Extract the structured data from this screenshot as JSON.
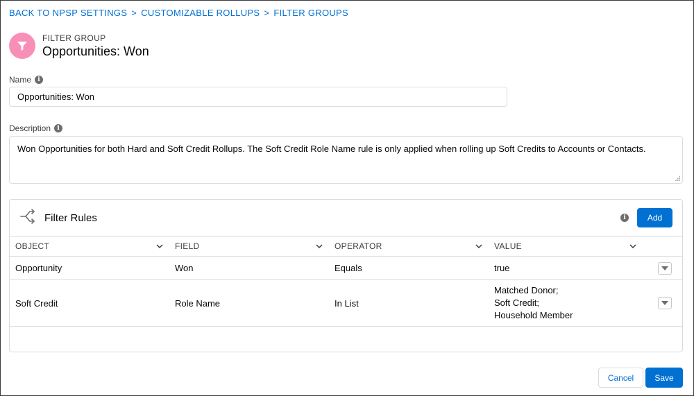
{
  "breadcrumb": {
    "items": [
      "BACK TO NPSP SETTINGS",
      "CUSTOMIZABLE ROLLUPS",
      "FILTER GROUPS"
    ],
    "separator": ">"
  },
  "header": {
    "eyebrow": "FILTER GROUP",
    "title": "Opportunities: Won",
    "icon": "filter-icon",
    "icon_color": "#f88fb7"
  },
  "form": {
    "name_label": "Name",
    "name_value": "Opportunities: Won",
    "description_label": "Description",
    "description_value": "Won Opportunities for both Hard and Soft Credit Rollups. The Soft Credit Role Name rule is only applied when rolling up Soft Credits to Accounts or Contacts."
  },
  "filter_rules": {
    "title": "Filter Rules",
    "add_label": "Add",
    "columns": [
      "OBJECT",
      "FIELD",
      "OPERATOR",
      "VALUE"
    ],
    "rows": [
      {
        "object": "Opportunity",
        "field": "Won",
        "operator": "Equals",
        "value": [
          "true"
        ]
      },
      {
        "object": "Soft Credit",
        "field": "Role Name",
        "operator": "In List",
        "value": [
          "Matched Donor;",
          "Soft Credit;",
          "Household Member"
        ]
      }
    ]
  },
  "footer": {
    "cancel_label": "Cancel",
    "save_label": "Save"
  },
  "colors": {
    "brand": "#0070d2",
    "icon_bg": "#f88fb7"
  }
}
